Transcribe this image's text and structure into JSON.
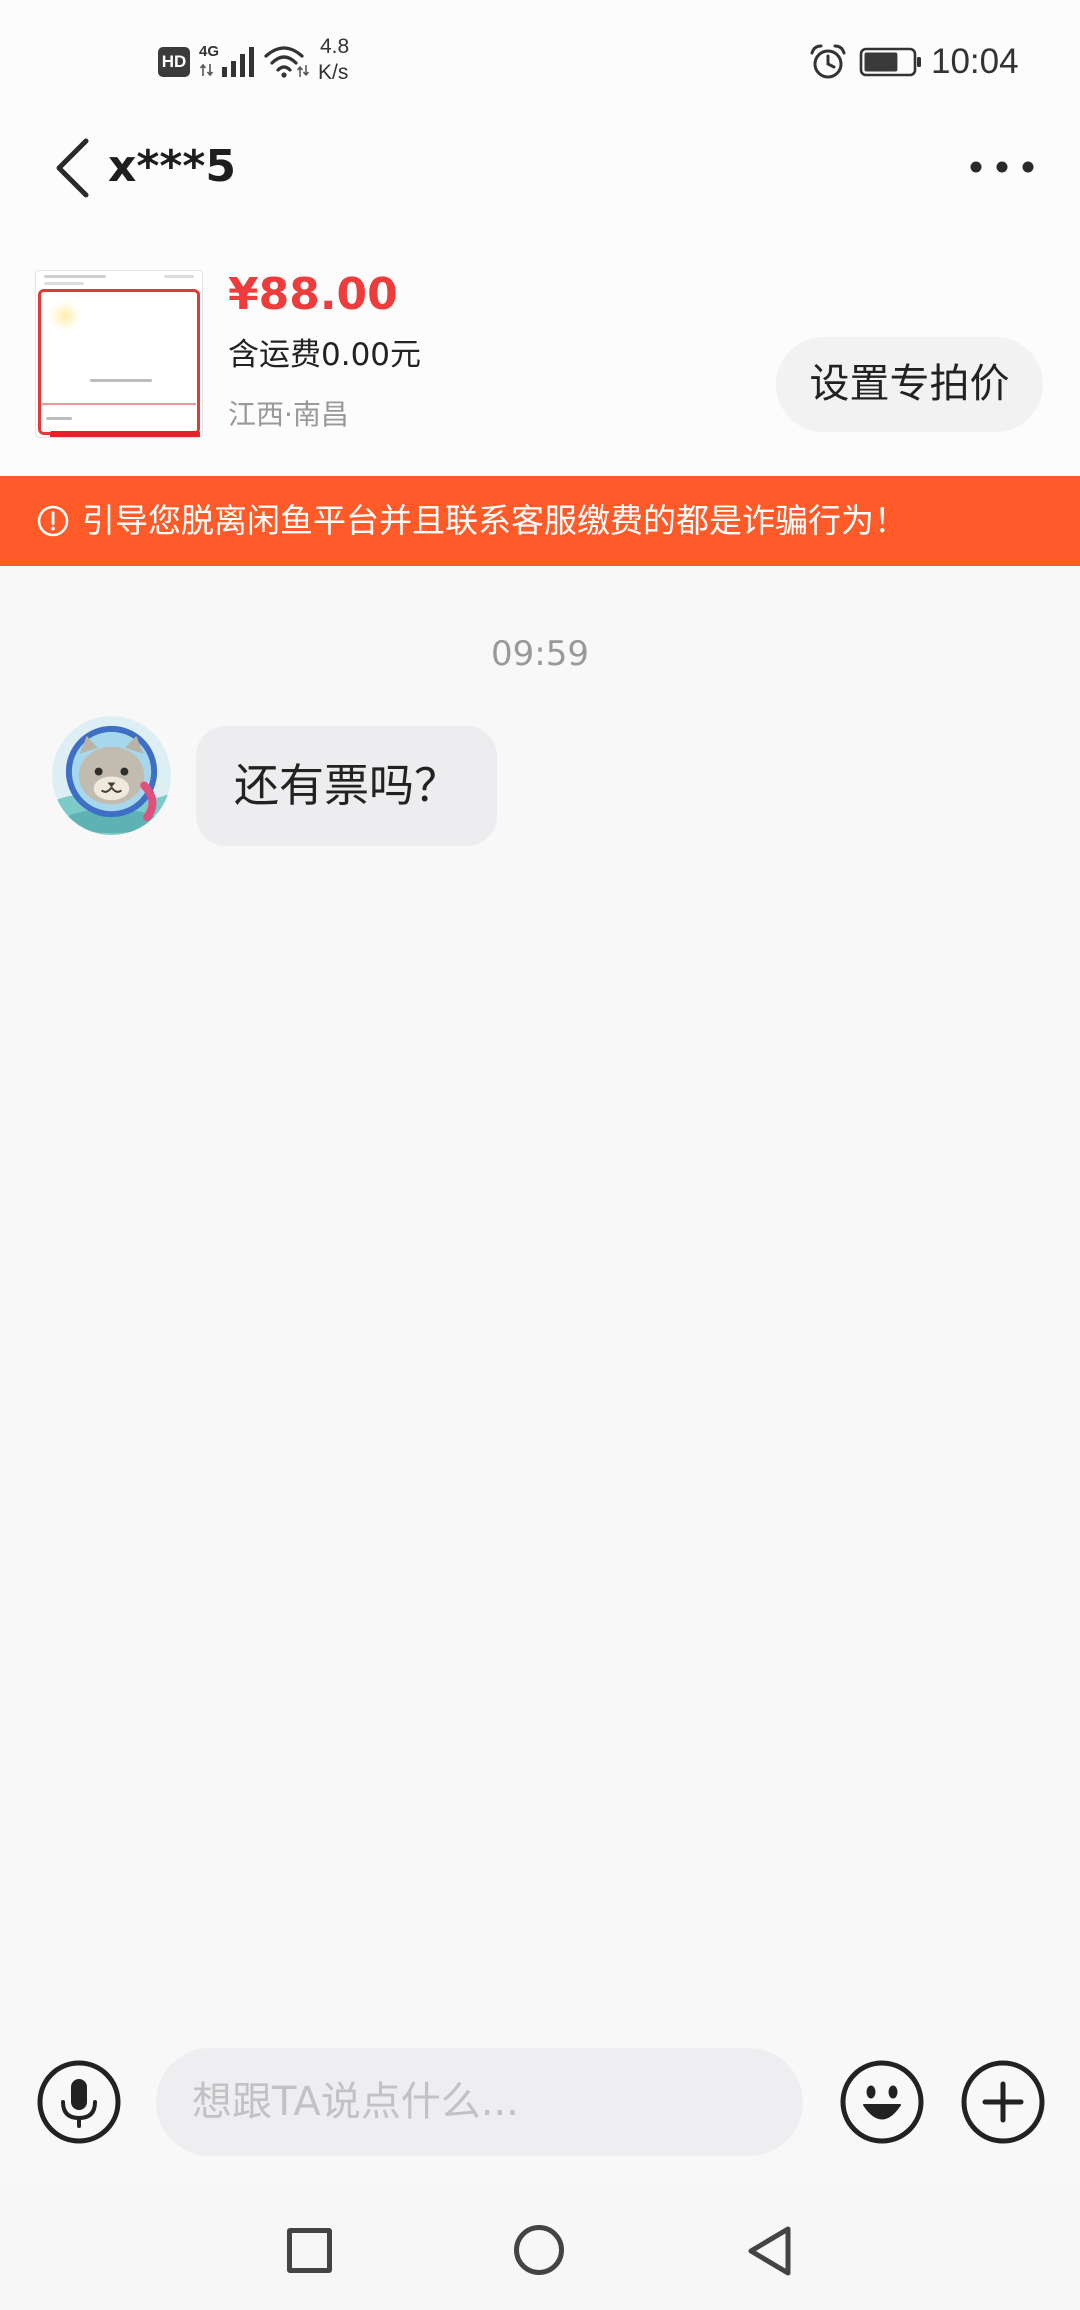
{
  "status_bar": {
    "hd_label": "HD",
    "network_label": "4G",
    "speed_value": "4.8",
    "speed_unit": "K/s",
    "time": "10:04",
    "battery_level": 0.7,
    "icons": [
      "hd-icon",
      "signal-icon",
      "wifi-icon",
      "alarm-icon",
      "battery-icon"
    ]
  },
  "header": {
    "title": "x***5",
    "back_icon": "chevron-left-icon",
    "more_icon": "more-dots-icon"
  },
  "product": {
    "price": "¥88.00",
    "shipping": "含运费0.00元",
    "location": "江西·南昌",
    "set_price_label": "设置专拍价"
  },
  "warning": {
    "icon": "alert-circle-icon",
    "text": "引导您脱离闲鱼平台并且联系客服缴费的都是诈骗行为！"
  },
  "chat": {
    "timestamp": "09:59",
    "messages": [
      {
        "text": "还有票吗？"
      }
    ]
  },
  "composer": {
    "placeholder": "想跟TA说点什么...",
    "voice_icon": "microphone-icon",
    "emoji_icon": "emoji-icon",
    "more_icon": "plus-circle-icon"
  },
  "nav_bar": {
    "recents_icon": "square-icon",
    "home_icon": "circle-icon",
    "back_icon": "triangle-back-icon"
  },
  "colors": {
    "price": "#EE3B3B",
    "warning_bg": "#FF5A28",
    "bubble_bg": "#EDEDEF",
    "input_bg": "#EEEEF0",
    "muted_text": "#999999"
  }
}
